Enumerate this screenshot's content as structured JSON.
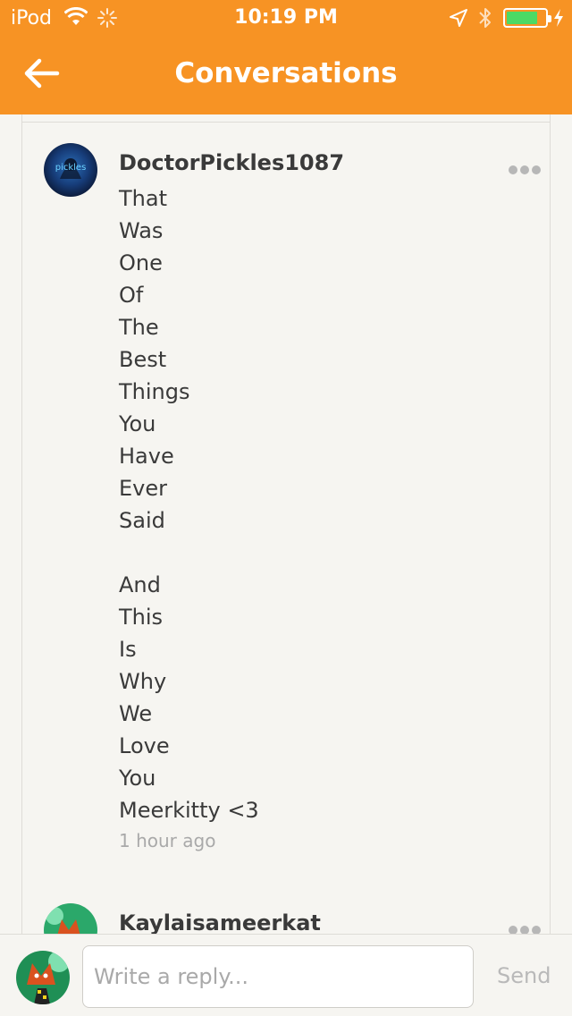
{
  "status_bar": {
    "carrier": "iPod",
    "time": "10:19 PM",
    "battery_level": 0.8
  },
  "header": {
    "title": "Conversations"
  },
  "messages": [
    {
      "username": "DoctorPickles1087",
      "avatar_text": "pickles",
      "lines": [
        "That",
        "Was",
        "One",
        "Of",
        "The",
        "Best",
        "Things",
        "You",
        "Have",
        "Ever",
        "Said",
        "",
        "And",
        "This",
        "Is",
        "Why",
        "We",
        "Love",
        "You",
        "Meerkitty <3"
      ],
      "time_ago": "1 hour ago"
    },
    {
      "username": "Kaylaisameerkat"
    }
  ],
  "reply": {
    "placeholder": "Write a reply...",
    "send_label": "Send"
  },
  "colors": {
    "accent": "#f79324",
    "battery": "#4cd964",
    "background": "#f6f5f1"
  }
}
